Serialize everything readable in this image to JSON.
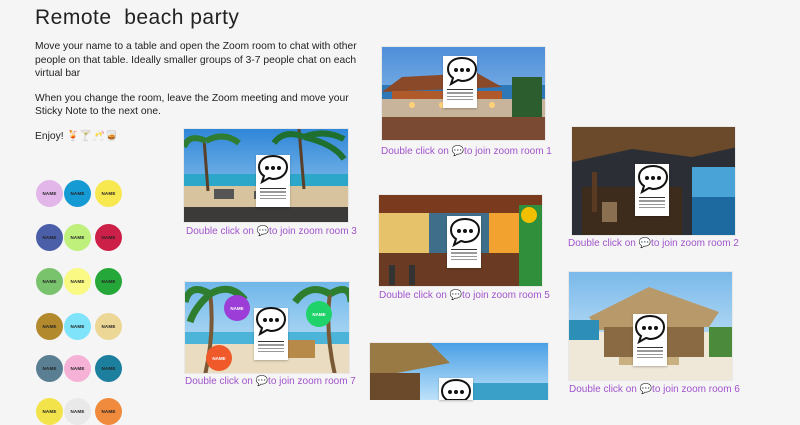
{
  "header": {
    "title": "Remote  beach party"
  },
  "intro": {
    "p1": "Move your name to a table and open the Zoom room to chat with other people on that table. Ideally smaller groups of 3-7 people chat on each virtual bar",
    "p2": "When you change the room, leave the Zoom meeting and move your Sticky Note to the next one.",
    "p3": "Enjoy! 🍹🍸🥂🥃"
  },
  "name_label": "NAME",
  "name_circles": [
    {
      "color": "#e3b6ea"
    },
    {
      "color": "#169ad3"
    },
    {
      "color": "#f8e84f"
    },
    {
      "color": "#4a5fa8"
    },
    {
      "color": "#bff07c"
    },
    {
      "color": "#cd2048"
    },
    {
      "color": "#78c36b"
    },
    {
      "color": "#f9f984"
    },
    {
      "color": "#26a739"
    },
    {
      "color": "#b2892c"
    },
    {
      "color": "#7fe3f9"
    },
    {
      "color": "#ecd796"
    },
    {
      "color": "#5a7f93"
    },
    {
      "color": "#f6b2d6"
    },
    {
      "color": "#1d7f9e"
    },
    {
      "color": "#f3e34b"
    },
    {
      "color": "#e9e9e9"
    },
    {
      "color": "#f08a3c"
    }
  ],
  "rooms": {
    "room1": {
      "caption_prefix": "Double click on ",
      "emoji": "💬",
      "caption_suffix": "to join zoom room 1"
    },
    "room2": {
      "caption_prefix": "Double click on ",
      "emoji": "💬",
      "caption_suffix": "to join zoom room 2"
    },
    "room3": {
      "caption_prefix": "Double click on ",
      "emoji": "💬",
      "caption_suffix": "to join zoom room 3"
    },
    "room5": {
      "caption_prefix": "Double click on ",
      "emoji": "💬",
      "caption_suffix": "to join zoom room 5"
    },
    "room6": {
      "caption_prefix": "Double click on ",
      "emoji": "💬",
      "caption_suffix": "to join zoom room 6"
    },
    "room7": {
      "caption_prefix": "Double click on ",
      "emoji": "💬",
      "caption_suffix": "to join zoom room 7"
    }
  },
  "room7_stickies": [
    {
      "label": "NAME",
      "color": "#9b3dd6"
    },
    {
      "label": "NAME",
      "color": "#1fd36a"
    },
    {
      "label": "NAME",
      "color": "#f05a2a"
    }
  ],
  "colors": {
    "caption": "#a154cc",
    "background": "#f5f5f5"
  }
}
